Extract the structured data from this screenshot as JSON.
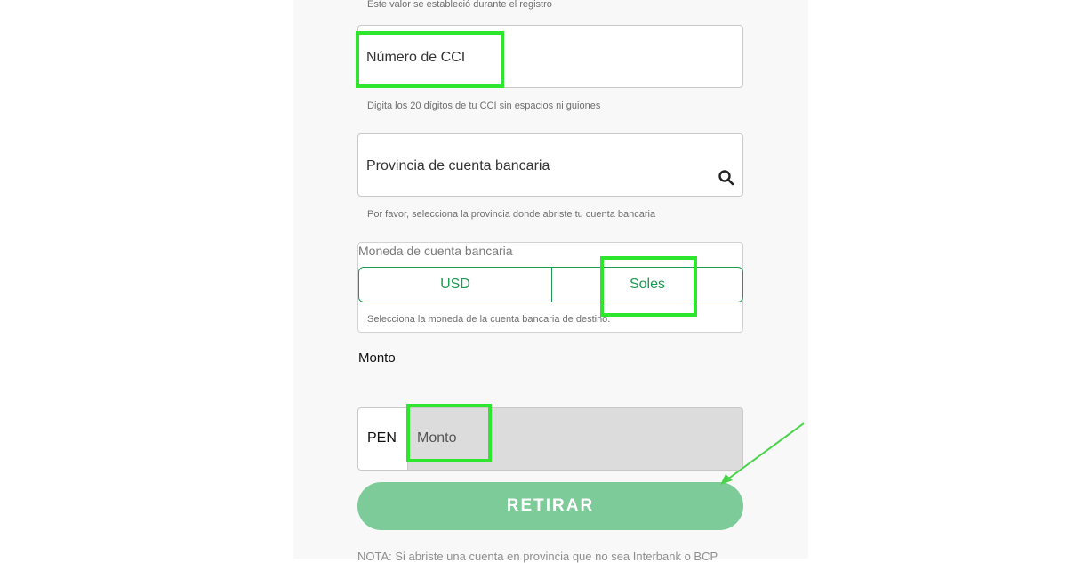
{
  "form": {
    "top_helper": "Este valor se estableció durante el registro",
    "cci": {
      "label": "Número de CCI",
      "helper": "Digita los 20 dígitos de tu CCI sin espacios ni guiones"
    },
    "provincia": {
      "label": "Provincia de cuenta bancaria",
      "icon": "search-icon",
      "helper": "Por favor, selecciona la provincia donde abriste tu cuenta bancaria"
    },
    "moneda": {
      "label": "Moneda de cuenta bancaria",
      "options": [
        "USD",
        "Soles"
      ],
      "helper": "Selecciona la moneda de la cuenta bancaria de destino."
    },
    "monto": {
      "section_title": "Monto",
      "currency": "PEN",
      "placeholder": "Monto"
    },
    "submit_label": "RETIRAR",
    "note": "NOTA: Si abriste una cuenta en provincia que no sea Interbank o BCP"
  },
  "colors": {
    "accent": "#1e9a52",
    "button": "#7ccb98",
    "highlight": "#2ee62e",
    "arrow": "#49d449"
  }
}
